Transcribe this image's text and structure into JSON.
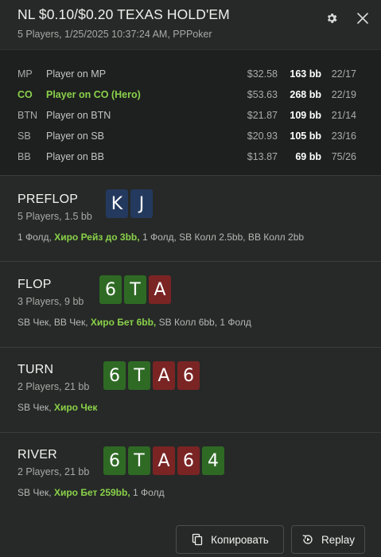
{
  "header": {
    "title": "NL $0.10/$0.20 TEXAS HOLD'EM",
    "subtitle": "5 Players, 1/25/2025 10:37:24 AM, PPPoker",
    "gear_icon": "gear-icon",
    "close_icon": "close-icon"
  },
  "players": [
    {
      "pos": "MP",
      "name": "Player on MP",
      "stack": "$32.58",
      "bb": "163 bb",
      "stat": "22/17",
      "hero": false
    },
    {
      "pos": "CO",
      "name": "Player on CO (Hero)",
      "stack": "$53.63",
      "bb": "268 bb",
      "stat": "22/19",
      "hero": true
    },
    {
      "pos": "BTN",
      "name": "Player on BTN",
      "stack": "$21.87",
      "bb": "109 bb",
      "stat": "21/14",
      "hero": false
    },
    {
      "pos": "SB",
      "name": "Player on SB",
      "stack": "$20.93",
      "bb": "105 bb",
      "stat": "23/16",
      "hero": false
    },
    {
      "pos": "BB",
      "name": "Player on BB",
      "stack": "$13.87",
      "bb": "69 bb",
      "stat": "75/26",
      "hero": false
    }
  ],
  "streets": {
    "preflop": {
      "name": "PREFLOP",
      "info": "5 Players, 1.5 bb",
      "cards": [
        {
          "rank": "K",
          "suit": "spade"
        },
        {
          "rank": "J",
          "suit": "spade"
        }
      ],
      "action_pre": "1 Фолд, ",
      "action_hero": "Хиро Рейз до 3bb,",
      "action_post": " 1 Фолд, SB Колл 2.5bb, BB Колл 2bb"
    },
    "flop": {
      "name": "FLOP",
      "info": "3 Players, 9 bb",
      "cards": [
        {
          "rank": "6",
          "suit": "club"
        },
        {
          "rank": "T",
          "suit": "club"
        },
        {
          "rank": "A",
          "suit": "heart"
        }
      ],
      "action_pre": "SB Чек, BB Чек, ",
      "action_hero": "Хиро Бет 6bb,",
      "action_post": " SB Колл 6bb, 1 Фолд"
    },
    "turn": {
      "name": "TURN",
      "info": "2 Players, 21 bb",
      "cards": [
        {
          "rank": "6",
          "suit": "club"
        },
        {
          "rank": "T",
          "suit": "club"
        },
        {
          "rank": "A",
          "suit": "heart"
        },
        {
          "rank": "6",
          "suit": "heart"
        }
      ],
      "action_pre": "SB Чек, ",
      "action_hero": "Хиро Чек",
      "action_post": ""
    },
    "river": {
      "name": "RIVER",
      "info": "2 Players, 21 bb",
      "cards": [
        {
          "rank": "6",
          "suit": "club"
        },
        {
          "rank": "T",
          "suit": "club"
        },
        {
          "rank": "A",
          "suit": "heart"
        },
        {
          "rank": "6",
          "suit": "heart"
        },
        {
          "rank": "4",
          "suit": "club"
        }
      ],
      "action_pre": "SB Чек, ",
      "action_hero": "Хиро Бет 259bb,",
      "action_post": " 1 Фолд"
    }
  },
  "footer": {
    "copy_label": "Копировать",
    "replay_label": "Replay",
    "copy_icon": "copy-icon",
    "replay_icon": "replay-icon"
  },
  "colors": {
    "hero": "#8ad14a",
    "spade": "#24395e",
    "club": "#2f6a25",
    "heart": "#7a2424",
    "background": "#262927",
    "panel": "#1e201f"
  }
}
